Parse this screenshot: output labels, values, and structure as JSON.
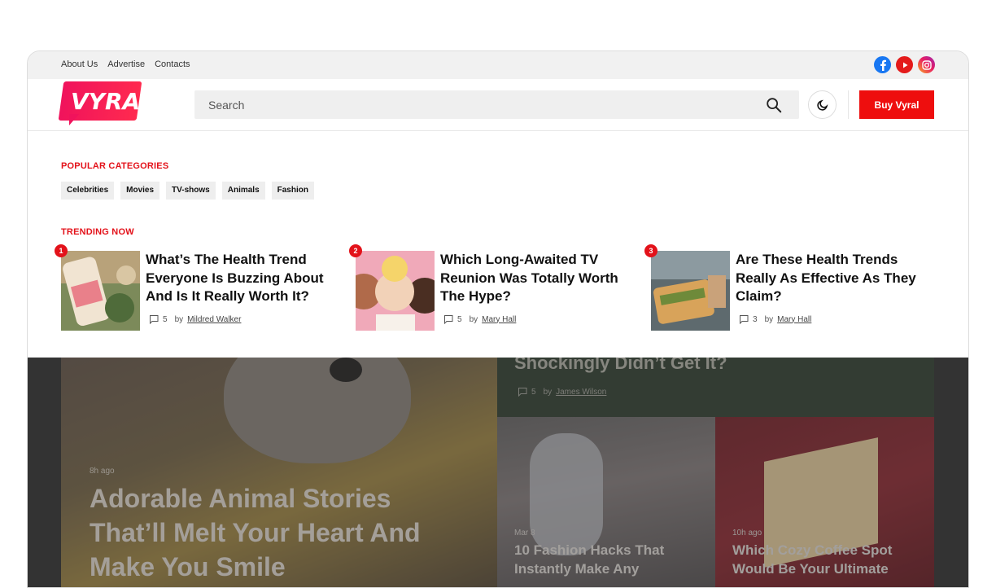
{
  "topbar": {
    "links": [
      "About Us",
      "Advertise",
      "Contacts"
    ],
    "social": [
      {
        "icon": "facebook-icon",
        "glyph": "f"
      },
      {
        "icon": "youtube-icon",
        "glyph": "▶"
      },
      {
        "icon": "instagram-icon",
        "glyph": "◎"
      }
    ]
  },
  "header": {
    "logo_text": "VYRAL",
    "search_placeholder": "Search",
    "buy_label": "Buy Vyral"
  },
  "panel": {
    "categories_title": "POPULAR CATEGORIES",
    "categories": [
      "Celebrities",
      "Movies",
      "TV-shows",
      "Animals",
      "Fashion"
    ],
    "trending_title": "TRENDING NOW",
    "trending": [
      {
        "rank": "1",
        "title": "What’s The Health Trend Everyone Is Buzzing About And Is It Really Worth It?",
        "comments": "5",
        "by": "by",
        "author": "Mildred Walker"
      },
      {
        "rank": "2",
        "title": "Which Long-Awaited TV Reunion Was Totally Worth The Hype?",
        "comments": "5",
        "by": "by",
        "author": "Mary Hall"
      },
      {
        "rank": "3",
        "title": "Are These Health Trends Really As Effective As They Claim?",
        "comments": "3",
        "by": "by",
        "author": "Mary Hall"
      }
    ]
  },
  "background": {
    "hero_time": "8h ago",
    "hero_title": "Adorable Animal Stories That’ll Melt Your Heart And Make You Smile",
    "top_right_title": "Shockingly Didn’t Get It?",
    "top_right_comments": "5",
    "top_right_by": "by",
    "top_right_author": "James Wilson",
    "card_a_time": "Mar 8",
    "card_a_title": "10 Fashion Hacks That Instantly Make Any",
    "card_b_time": "10h ago",
    "card_b_title": "Which Cozy Coffee Spot Would Be Your Ultimate"
  },
  "colors": {
    "accent": "#ee0e0e",
    "brand_gradient_start": "#f0135c",
    "brand_gradient_end": "#ff2a4f"
  }
}
